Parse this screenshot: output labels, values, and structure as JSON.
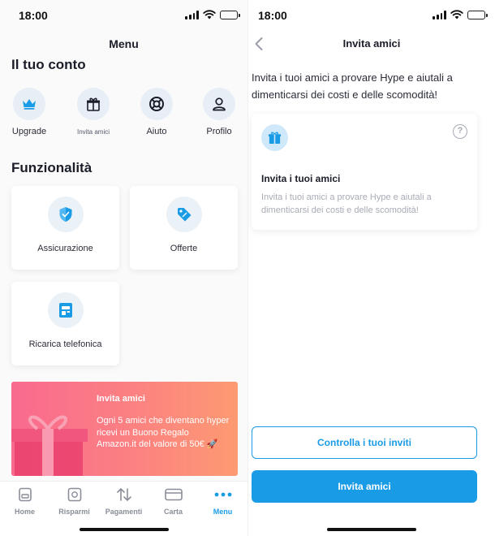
{
  "status_bar": {
    "time": "18:00"
  },
  "menu_screen": {
    "title": "Menu",
    "account_section": {
      "title": "Il tuo conto",
      "items": [
        {
          "label": "Upgrade",
          "icon": "crown-icon"
        },
        {
          "label": "Invita amici",
          "icon": "gift-icon"
        },
        {
          "label": "Aiuto",
          "icon": "lifebuoy-icon"
        },
        {
          "label": "Profilo",
          "icon": "user-icon"
        }
      ]
    },
    "features_section": {
      "title": "Funzionalità",
      "cards": [
        {
          "label": "Assicurazione",
          "icon": "shield-icon"
        },
        {
          "label": "Offerte",
          "icon": "tag-icon"
        },
        {
          "label": "Ricarica telefonica",
          "icon": "sim-card-icon"
        }
      ]
    },
    "promo": {
      "title": "Invita amici",
      "text": "Ogni 5 amici che diventano hyper ricevi un Buono Regalo Amazon.it del valore di 50€ 🚀"
    },
    "tabbar": [
      {
        "label": "Home",
        "icon": "home-icon",
        "active": false
      },
      {
        "label": "Risparmi",
        "icon": "safe-icon",
        "active": false
      },
      {
        "label": "Pagamenti",
        "icon": "transfer-arrows-icon",
        "active": false
      },
      {
        "label": "Carta",
        "icon": "card-icon",
        "active": false
      },
      {
        "label": "Menu",
        "icon": "dots-icon",
        "active": true
      }
    ]
  },
  "invite_screen": {
    "title": "Invita amici",
    "intro": "Invita i tuoi amici a provare Hype e aiutali a dimenticarsi dei costi e delle scomodità!",
    "card": {
      "title": "Invita i tuoi amici",
      "text": "Invita i tuoi amici a provare Hype e aiutali a dimenticarsi dei costi e delle scomodità!",
      "help_symbol": "?"
    },
    "secondary_button": "Controlla i tuoi inviti",
    "primary_button": "Invita amici"
  },
  "colors": {
    "accent": "#1a9be6",
    "icon_blue": "#1a9be6",
    "promo_gradient_start": "#f96a8f",
    "promo_gradient_end": "#fd9a72"
  }
}
